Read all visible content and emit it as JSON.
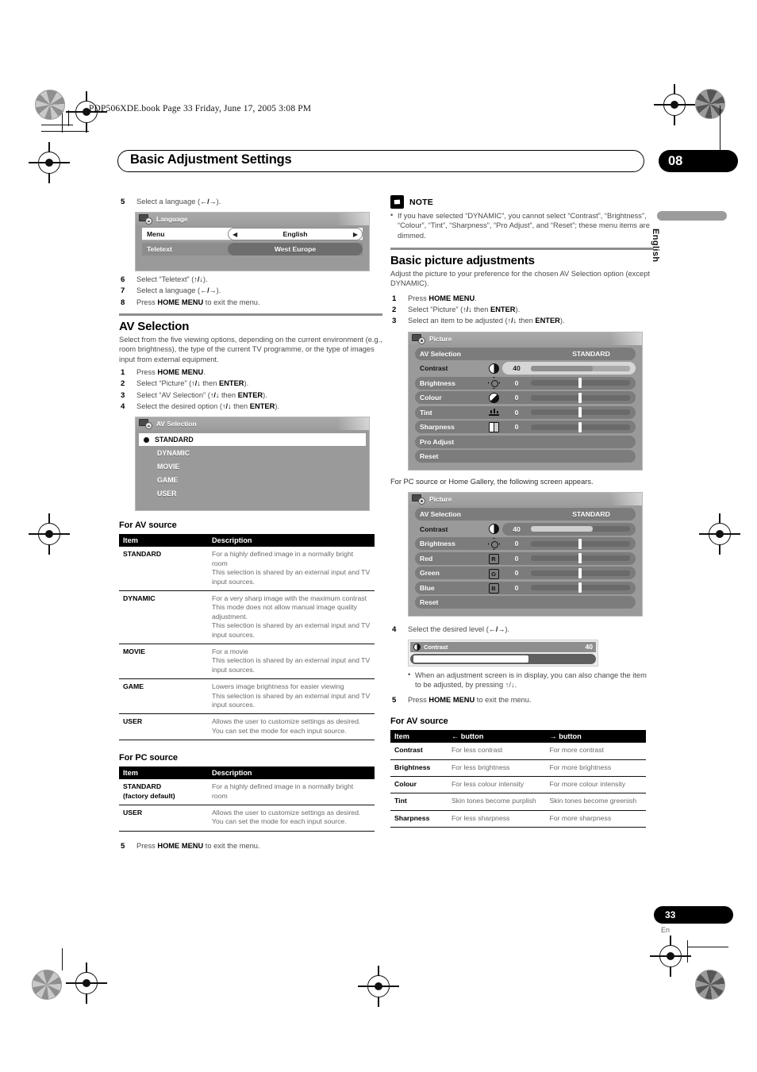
{
  "print_header": "PDP506XDE.book  Page 33  Friday, June 17, 2005  3:08 PM",
  "chapter": {
    "title": "Basic Adjustment Settings",
    "number": "08"
  },
  "side_tab_label": "English",
  "footer": {
    "page": "33",
    "lang": "En"
  },
  "left": {
    "step5": {
      "n": "5",
      "text_before": "Select a language (",
      "arrows": "←/→",
      "text_after": ")."
    },
    "language_osd": {
      "title": "Language",
      "rows": [
        {
          "label": "Menu",
          "value": "English",
          "style": "white-left-right"
        },
        {
          "label": "Teletext",
          "value": "West Europe",
          "style": "grey"
        }
      ]
    },
    "steps_678": [
      {
        "n": "6",
        "pre": "Select “Teletext” (",
        "arrows": "↑/↓",
        "post": ")."
      },
      {
        "n": "7",
        "pre": "Select a language (",
        "arrows": "←/→",
        "post": ")."
      },
      {
        "n": "8",
        "pre": "Press ",
        "bold": "HOME MENU",
        "post": " to exit the menu."
      }
    ],
    "av_selection": {
      "heading": "AV Selection",
      "intro": "Select from the five viewing options, depending on the current environment (e.g., room brightness), the type of the current TV programme, or the type of images input from external equipment.",
      "steps": [
        {
          "n": "1",
          "pre": "Press ",
          "bold": "HOME MENU",
          "post": "."
        },
        {
          "n": "2",
          "pre": "Select “Picture” (",
          "arrows": "↑/↓",
          "mid": " then ",
          "bold": "ENTER",
          "post": ")."
        },
        {
          "n": "3",
          "pre": "Select “AV Selection” (",
          "arrows": "↑/↓",
          "mid": " then ",
          "bold": "ENTER",
          "post": ")."
        },
        {
          "n": "4",
          "pre": "Select the desired option (",
          "arrows": "↑/↓",
          "mid": " then ",
          "bold": "ENTER",
          "post": ")."
        }
      ],
      "osd": {
        "title": "AV Selection",
        "items": [
          "STANDARD",
          "DYNAMIC",
          "MOVIE",
          "GAME",
          "USER"
        ],
        "selected": "STANDARD"
      }
    },
    "av_table": {
      "heading": "For AV source",
      "columns": [
        "Item",
        "Description"
      ],
      "rows": [
        {
          "item": "STANDARD",
          "desc": "For a highly defined image in a normally bright room\nThis selection is shared by an external input and TV input sources."
        },
        {
          "item": "DYNAMIC",
          "desc": "For a very sharp image with the maximum contrast\nThis mode does not allow manual image quality adjustment.\nThis selection is shared by an external input and TV input sources."
        },
        {
          "item": "MOVIE",
          "desc": "For a movie\nThis selection is shared by an external input and TV input sources."
        },
        {
          "item": "GAME",
          "desc": "Lowers image brightness for easier viewing\nThis selection is shared by an external input and TV input sources."
        },
        {
          "item": "USER",
          "desc": "Allows the user to customize settings as desired. You can set the mode for each input source."
        }
      ]
    },
    "pc_table": {
      "heading": "For PC source",
      "columns": [
        "Item",
        "Description"
      ],
      "rows": [
        {
          "item": "STANDARD\n(factory default)",
          "desc": "For a highly defined image in a normally bright room"
        },
        {
          "item": "USER",
          "desc": "Allows the user to customize settings as desired. You can set the mode for each input source."
        }
      ]
    },
    "final_step": {
      "n": "5",
      "pre": "Press ",
      "bold": "HOME MENU",
      "post": " to exit the menu."
    }
  },
  "right": {
    "note": {
      "title": "NOTE",
      "items": [
        "If you have selected “DYNAMIC”, you cannot select “Contrast”, “Brightness”, “Colour”, “Tint”, “Sharpness”, “Pro Adjust”, and “Reset”; these menu items are dimmed."
      ]
    },
    "basic_picture": {
      "heading": "Basic picture adjustments",
      "intro": "Adjust the picture to your preference for the chosen AV Selection option (except DYNAMIC).",
      "steps": [
        {
          "n": "1",
          "pre": "Press ",
          "bold": "HOME MENU",
          "post": "."
        },
        {
          "n": "2",
          "pre": "Select “Picture” (",
          "arrows": "↑/↓",
          "mid": " then ",
          "bold": "ENTER",
          "post": ")."
        },
        {
          "n": "3",
          "pre": "Select an item to be adjusted (",
          "arrows": "↑/↓",
          "mid": " then ",
          "bold": "ENTER",
          "post": ")."
        }
      ]
    },
    "picture_osd_av": {
      "title": "Picture",
      "rows": [
        {
          "label": "AV Selection",
          "type": "text",
          "value": "STANDARD"
        },
        {
          "label": "Contrast",
          "type": "slider",
          "icon": "contrast-icon",
          "value": "40",
          "fill_pct": 62,
          "light": true
        },
        {
          "label": "Brightness",
          "type": "slider",
          "icon": "brightness-icon",
          "value": "0",
          "knob_pct": 50
        },
        {
          "label": "Colour",
          "type": "slider",
          "icon": "colour-icon",
          "value": "0",
          "knob_pct": 50
        },
        {
          "label": "Tint",
          "type": "slider",
          "icon": "tint-icon",
          "value": "0",
          "knob_pct": 50
        },
        {
          "label": "Sharpness",
          "type": "slider",
          "icon": "sharpness-icon",
          "value": "0",
          "knob_pct": 50
        },
        {
          "label": "Pro Adjust",
          "type": "plain"
        },
        {
          "label": "Reset",
          "type": "plain"
        }
      ]
    },
    "pc_note": "For PC source or Home Gallery, the following screen appears.",
    "picture_osd_pc": {
      "title": "Picture",
      "rows": [
        {
          "label": "AV Selection",
          "type": "text",
          "value": "STANDARD"
        },
        {
          "label": "Contrast",
          "type": "slider",
          "icon": "contrast-icon",
          "value": "40",
          "fill_pct": 62
        },
        {
          "label": "Brightness",
          "type": "slider",
          "icon": "brightness-icon",
          "value": "0",
          "knob_pct": 50
        },
        {
          "label": "Red",
          "type": "slider",
          "icon": "red-icon",
          "value": "0",
          "knob_pct": 50
        },
        {
          "label": "Green",
          "type": "slider",
          "icon": "green-icon",
          "value": "0",
          "knob_pct": 50
        },
        {
          "label": "Blue",
          "type": "slider",
          "icon": "blue-icon",
          "value": "0",
          "knob_pct": 50
        },
        {
          "label": "Reset",
          "type": "plain"
        }
      ]
    },
    "step4": {
      "n": "4",
      "pre": "Select the desired level (",
      "arrows": "←/→",
      "post": ")."
    },
    "adjust_bar": {
      "label": "Contrast",
      "value": "40",
      "fill_pct": 62
    },
    "bullet": "When an adjustment screen is in display, you can also change the item to be adjusted, by pressing ↑/↓.",
    "step5": {
      "n": "5",
      "pre": "Press ",
      "bold": "HOME MENU",
      "post": " to exit the menu."
    },
    "button_table": {
      "heading": "For AV source",
      "columns": [
        "Item",
        "← button",
        "→ button"
      ],
      "rows": [
        {
          "item": "Contrast",
          "left": "For less contrast",
          "right": "For more contrast"
        },
        {
          "item": "Brightness",
          "left": "For less brightness",
          "right": "For more brightness"
        },
        {
          "item": "Colour",
          "left": "For less colour intensity",
          "right": "For more colour intensity"
        },
        {
          "item": "Tint",
          "left": "Skin tones become purplish",
          "right": "Skin tones become greenish"
        },
        {
          "item": "Sharpness",
          "left": "For less sharpness",
          "right": "For more sharpness"
        }
      ]
    }
  }
}
